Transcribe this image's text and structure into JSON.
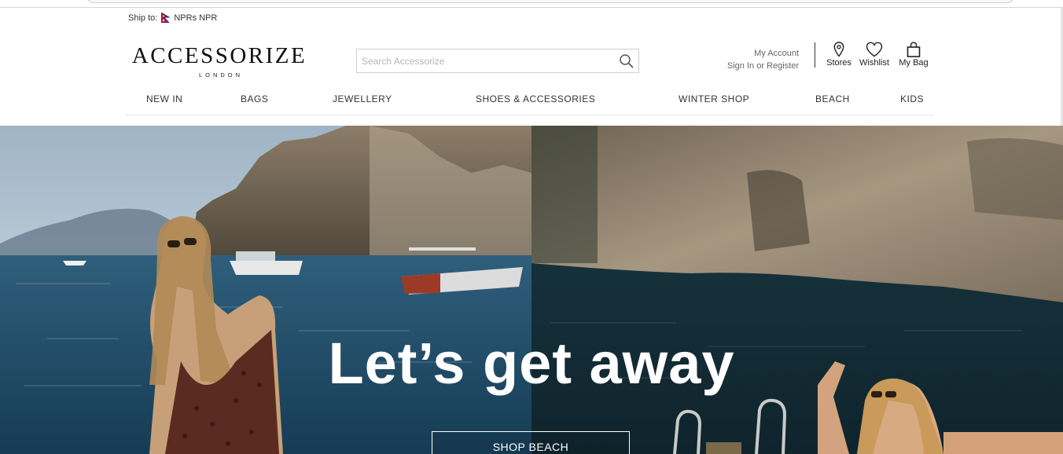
{
  "header": {
    "ship_to_label": "Ship to:",
    "currency": "NPRs NPR",
    "flag_icon": "nepal-flag-icon"
  },
  "logo": {
    "main": "ACCESSORIZE",
    "sub": "LONDON"
  },
  "search": {
    "placeholder": "Search Accessorize",
    "value": "",
    "icon": "search-icon"
  },
  "account": {
    "title": "My Account",
    "signin": "Sign In or Register"
  },
  "utilities": {
    "stores": {
      "label": "Stores",
      "icon": "location-pin-icon"
    },
    "wishlist": {
      "label": "Wishlist",
      "icon": "heart-icon"
    },
    "bag": {
      "label": "My Bag",
      "icon": "shopping-bag-icon"
    }
  },
  "nav": {
    "items": [
      {
        "label": "NEW IN"
      },
      {
        "label": "BAGS"
      },
      {
        "label": "JEWELLERY"
      },
      {
        "label": "SHOES & ACCESSORIES"
      },
      {
        "label": "WINTER SHOP"
      },
      {
        "label": "BEACH"
      },
      {
        "label": "KIDS"
      }
    ]
  },
  "hero": {
    "headline": "Let’s get away",
    "cta": "SHOP BEACH"
  },
  "colors": {
    "text": "#333333",
    "border": "#cfcfcf",
    "hero_text": "#ffffff"
  }
}
